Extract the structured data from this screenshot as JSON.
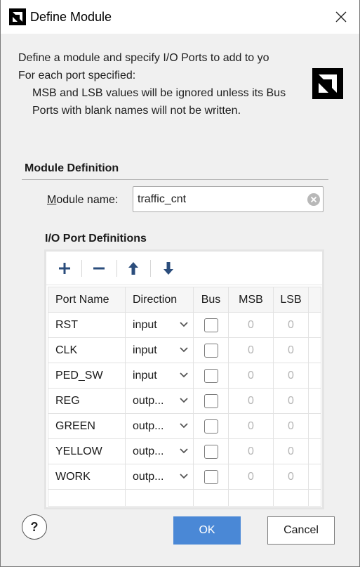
{
  "window": {
    "title": "Define Module",
    "close_icon": "close-icon",
    "logo_icon": "amd-logo-icon"
  },
  "intro": {
    "line1": "Define a module and specify I/O Ports to add to yo",
    "line2": "For each port specified:",
    "line3": "MSB and LSB values will be ignored unless its Bus",
    "line4": "Ports with blank names will not be written."
  },
  "module_definition": {
    "title": "Module Definition",
    "name_label_access": "M",
    "name_label_rest": "odule name:",
    "name_value": "traffic_cnt"
  },
  "ports": {
    "title": "I/O Port Definitions",
    "toolbar": [
      "add-icon",
      "remove-icon",
      "move-up-icon",
      "move-down-icon"
    ],
    "columns": [
      "Port Name",
      "Direction",
      "Bus",
      "MSB",
      "LSB"
    ],
    "rows": [
      {
        "name": "RST",
        "direction": "input",
        "bus": false,
        "msb": "0",
        "lsb": "0"
      },
      {
        "name": "CLK",
        "direction": "input",
        "bus": false,
        "msb": "0",
        "lsb": "0"
      },
      {
        "name": "PED_SW",
        "direction": "input",
        "bus": false,
        "msb": "0",
        "lsb": "0"
      },
      {
        "name": "REG",
        "direction": "outp...",
        "bus": false,
        "msb": "0",
        "lsb": "0"
      },
      {
        "name": "GREEN",
        "direction": "outp...",
        "bus": false,
        "msb": "0",
        "lsb": "0"
      },
      {
        "name": "YELLOW",
        "direction": "outp...",
        "bus": false,
        "msb": "0",
        "lsb": "0"
      },
      {
        "name": "WORK",
        "direction": "outp...",
        "bus": false,
        "msb": "0",
        "lsb": "0"
      }
    ]
  },
  "footer": {
    "help": "?",
    "ok": "OK",
    "cancel": "Cancel"
  },
  "colors": {
    "ok_button": "#4a88d6",
    "toolbar_icon": "#2b4d7c"
  }
}
